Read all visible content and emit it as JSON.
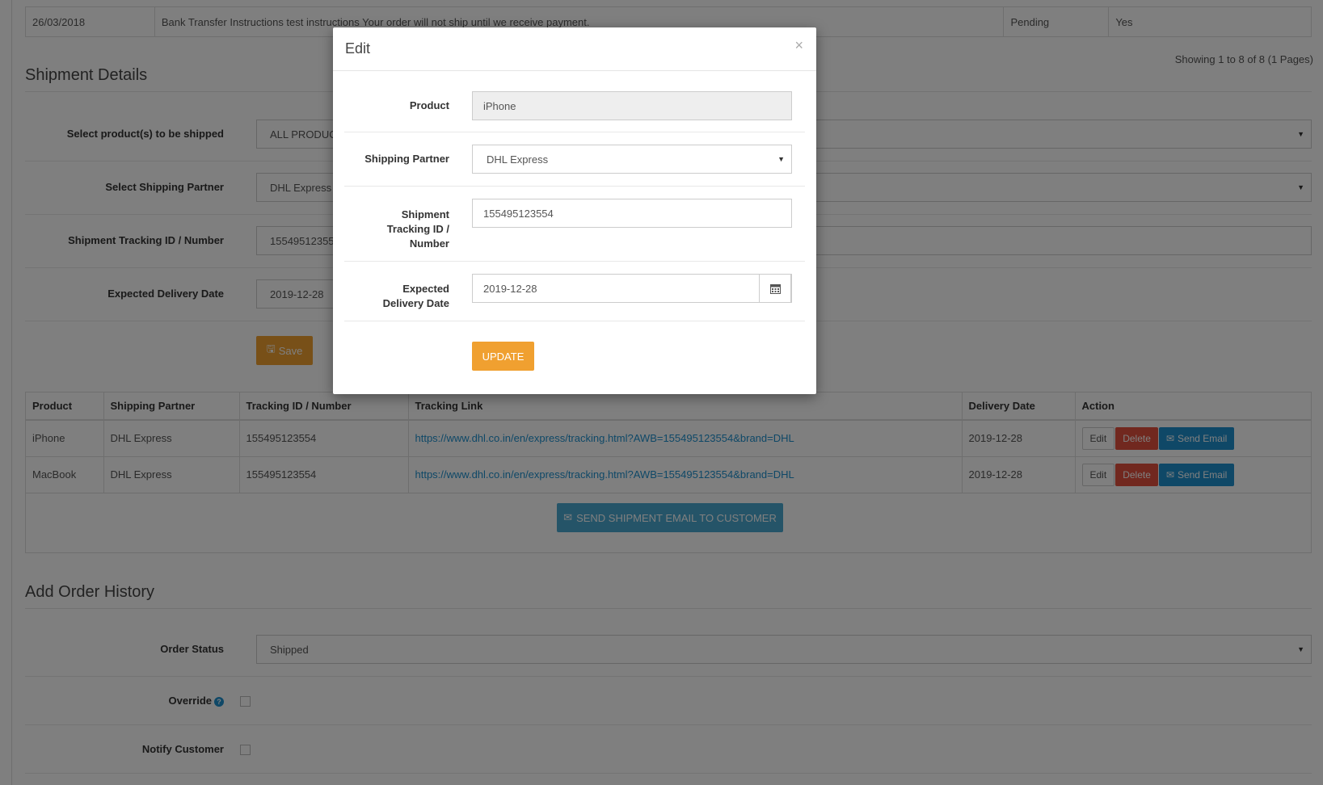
{
  "history_row": {
    "date": "26/03/2018",
    "comment": "Bank Transfer Instructions test instructions Your order will not ship until we receive payment.",
    "status": "Pending",
    "notified": "Yes"
  },
  "pagination": "Showing 1 to 8 of 8 (1 Pages)",
  "shipment": {
    "title": "Shipment Details",
    "product_label": "Select product(s) to be shipped",
    "product_value": "ALL PRODUCTS",
    "partner_label": "Select Shipping Partner",
    "partner_value": "DHL Express",
    "tracking_label": "Shipment Tracking ID / Number",
    "tracking_value": "155495123554",
    "date_label": "Expected Delivery Date",
    "date_value": "2019-12-28",
    "save_label": "Save"
  },
  "table": {
    "headers": [
      "Product",
      "Shipping Partner",
      "Tracking ID / Number",
      "Tracking Link",
      "Delivery Date",
      "Action"
    ],
    "rows": [
      {
        "product": "iPhone",
        "partner": "DHL Express",
        "tracking": "155495123554",
        "link": "https://www.dhl.co.in/en/express/tracking.html?AWB=155495123554&brand=DHL",
        "date": "2019-12-28"
      },
      {
        "product": "MacBook",
        "partner": "DHL Express",
        "tracking": "155495123554",
        "link": "https://www.dhl.co.in/en/express/tracking.html?AWB=155495123554&brand=DHL",
        "date": "2019-12-28"
      }
    ],
    "edit_label": "Edit",
    "delete_label": "Delete",
    "email_label": "Send Email",
    "send_all_label": "SEND SHIPMENT EMAIL TO CUSTOMER"
  },
  "history": {
    "title": "Add Order History",
    "status_label": "Order Status",
    "status_value": "Shipped",
    "override_label": "Override",
    "notify_label": "Notify Customer"
  },
  "modal": {
    "title": "Edit",
    "close": "×",
    "product_label": "Product",
    "product_value": "iPhone",
    "partner_label": "Shipping Partner",
    "partner_value": "DHL Express",
    "tracking_label_1": "Shipment",
    "tracking_label_2": "Tracking ID /",
    "tracking_label_3": "Number",
    "tracking_value": "155495123554",
    "date_label_1": "Expected",
    "date_label_2": "Delivery Date",
    "date_value": "2019-12-28",
    "update_label": "UPDATE"
  }
}
